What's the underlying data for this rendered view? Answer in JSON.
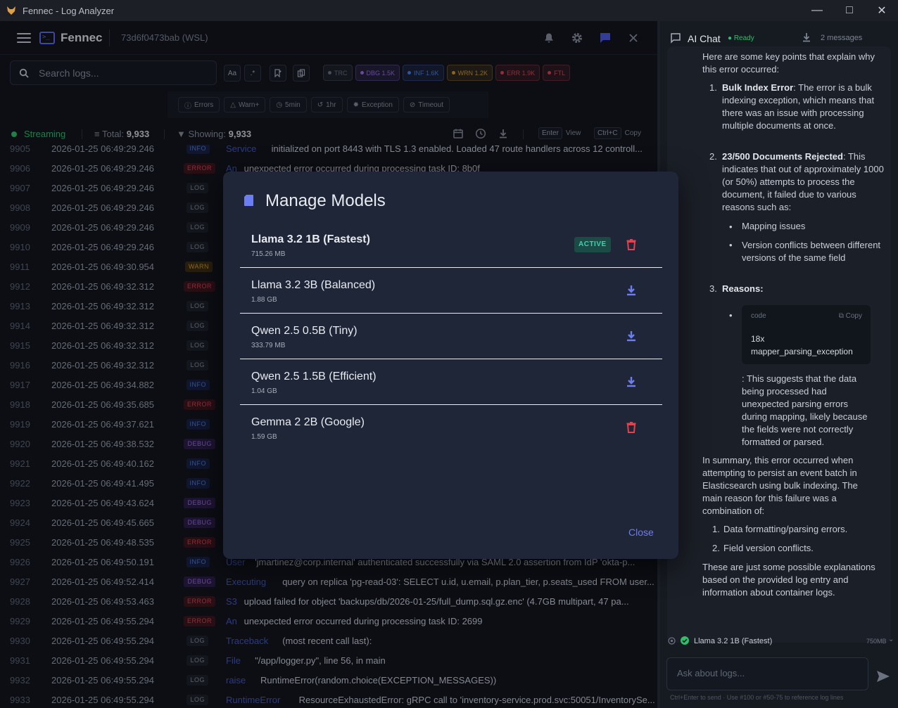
{
  "window": {
    "title": "Fennec - Log Analyzer"
  },
  "header": {
    "brand": "Fennec",
    "host": "73d6f0473bab (WSL)"
  },
  "search": {
    "placeholder": "Search logs..."
  },
  "toolbar": {
    "case_label": "Aa",
    "regex_label": ".*"
  },
  "levels": [
    {
      "label": "TRC",
      "color": "#6b7280"
    },
    {
      "label": "DBG 1.5K",
      "color": "#9b6ef0"
    },
    {
      "label": "INF 1.6K",
      "color": "#4a7ee8"
    },
    {
      "label": "WRN 1.2K",
      "color": "#d79a2c"
    },
    {
      "label": "ERR 1.9K",
      "color": "#e0424f"
    },
    {
      "label": "FTL",
      "color": "#e0424f"
    }
  ],
  "quick_filters": [
    "Errors",
    "Warn+",
    "5min",
    "1hr",
    "Exception",
    "Timeout"
  ],
  "status": {
    "streaming": "Streaming",
    "total_label": "Total:",
    "total": "9,933",
    "showing_label": "Showing:",
    "showing": "9,933",
    "enter_key": "Enter",
    "view": "View",
    "copy_key": "Ctrl+C",
    "copy": "Copy"
  },
  "logs": [
    {
      "ln": "9905",
      "ts": "2026-01-25 06:49:29.246",
      "lvl": "INFO",
      "src": "Service",
      "msg": "initialized on port 8443 with TLS 1.3 enabled. Loaded 47 route handlers across 12 controll..."
    },
    {
      "ln": "9906",
      "ts": "2026-01-25 06:49:29.246",
      "lvl": "ERROR",
      "src": "An",
      "msg": "unexpected error occurred during processing task ID: 8b0f"
    },
    {
      "ln": "9907",
      "ts": "2026-01-25 06:49:29.246",
      "lvl": "LOG",
      "src": "",
      "msg": ""
    },
    {
      "ln": "9908",
      "ts": "2026-01-25 06:49:29.246",
      "lvl": "LOG",
      "src": "",
      "msg": ""
    },
    {
      "ln": "9909",
      "ts": "2026-01-25 06:49:29.246",
      "lvl": "LOG",
      "src": "",
      "msg": ""
    },
    {
      "ln": "9910",
      "ts": "2026-01-25 06:49:29.246",
      "lvl": "LOG",
      "src": "",
      "msg": ""
    },
    {
      "ln": "9911",
      "ts": "2026-01-25 06:49:30.954",
      "lvl": "WARN",
      "src": "",
      "msg": ""
    },
    {
      "ln": "9912",
      "ts": "2026-01-25 06:49:32.312",
      "lvl": "ERROR",
      "src": "",
      "msg": ""
    },
    {
      "ln": "9913",
      "ts": "2026-01-25 06:49:32.312",
      "lvl": "LOG",
      "src": "",
      "msg": ""
    },
    {
      "ln": "9914",
      "ts": "2026-01-25 06:49:32.312",
      "lvl": "LOG",
      "src": "",
      "msg": ""
    },
    {
      "ln": "9915",
      "ts": "2026-01-25 06:49:32.312",
      "lvl": "LOG",
      "src": "",
      "msg": ""
    },
    {
      "ln": "9916",
      "ts": "2026-01-25 06:49:32.312",
      "lvl": "LOG",
      "src": "",
      "msg": ""
    },
    {
      "ln": "9917",
      "ts": "2026-01-25 06:49:34.882",
      "lvl": "INFO",
      "src": "",
      "msg": ""
    },
    {
      "ln": "9918",
      "ts": "2026-01-25 06:49:35.685",
      "lvl": "ERROR",
      "src": "",
      "msg": ""
    },
    {
      "ln": "9919",
      "ts": "2026-01-25 06:49:37.621",
      "lvl": "INFO",
      "src": "",
      "msg": ""
    },
    {
      "ln": "9920",
      "ts": "2026-01-25 06:49:38.532",
      "lvl": "DEBUG",
      "src": "",
      "msg": ""
    },
    {
      "ln": "9921",
      "ts": "2026-01-25 06:49:40.162",
      "lvl": "INFO",
      "src": "",
      "msg": ""
    },
    {
      "ln": "9922",
      "ts": "2026-01-25 06:49:41.495",
      "lvl": "INFO",
      "src": "",
      "msg": ""
    },
    {
      "ln": "9923",
      "ts": "2026-01-25 06:49:43.624",
      "lvl": "DEBUG",
      "src": "",
      "msg": ""
    },
    {
      "ln": "9924",
      "ts": "2026-01-25 06:49:45.665",
      "lvl": "DEBUG",
      "src": "",
      "msg": ""
    },
    {
      "ln": "9925",
      "ts": "2026-01-25 06:49:48.535",
      "lvl": "ERROR",
      "src": "",
      "msg": ""
    },
    {
      "ln": "9926",
      "ts": "2026-01-25 06:49:50.191",
      "lvl": "INFO",
      "src": "User",
      "msg": "'jmartinez@corp.internal' authenticated successfully via SAML 2.0 assertion from IdP 'okta-p..."
    },
    {
      "ln": "9927",
      "ts": "2026-01-25 06:49:52.414",
      "lvl": "DEBUG",
      "src": "Executing",
      "msg": "query on replica 'pg-read-03': SELECT u.id, u.email, p.plan_tier, p.seats_used FROM user..."
    },
    {
      "ln": "9928",
      "ts": "2026-01-25 06:49:53.463",
      "lvl": "ERROR",
      "src": "S3",
      "msg": "upload failed for object 'backups/db/2026-01-25/full_dump.sql.gz.enc' (4.7GB multipart, 47 pa..."
    },
    {
      "ln": "9929",
      "ts": "2026-01-25 06:49:55.294",
      "lvl": "ERROR",
      "src": "An",
      "msg": "unexpected error occurred during processing task ID: 2699"
    },
    {
      "ln": "9930",
      "ts": "2026-01-25 06:49:55.294",
      "lvl": "LOG",
      "src": "Traceback",
      "msg": "(most recent call last):"
    },
    {
      "ln": "9931",
      "ts": "2026-01-25 06:49:55.294",
      "lvl": "LOG",
      "src": "File",
      "msg": "\"/app/logger.py\", line 56, in main"
    },
    {
      "ln": "9932",
      "ts": "2026-01-25 06:49:55.294",
      "lvl": "LOG",
      "src": "raise",
      "msg": "RuntimeError(random.choice(EXCEPTION_MESSAGES))"
    },
    {
      "ln": "9933",
      "ts": "2026-01-25 06:49:55.294",
      "lvl": "LOG",
      "src": "RuntimeError",
      "msg": "ResourceExhaustedError: gRPC call to 'inventory-service.prod.svc:50051/InventorySe..."
    }
  ],
  "chat": {
    "title": "AI Chat",
    "status": "Ready",
    "message_count": "2 messages",
    "intro": "Here are some key points that explain why this error occurred:",
    "p1_title": "Bulk Index Error",
    "p1_text": ": The error is a bulk indexing exception, which means that there was an issue with processing multiple documents at once.",
    "p2_title": "23/500 Documents Rejected",
    "p2_text": ": This indicates that out of approximately 1000 (or 50%) attempts to process the document, it failed due to various reasons such as:",
    "b1": "Mapping issues",
    "b2": "Version conflicts between different versions of the same field",
    "p3_title": "Reasons:",
    "code_lang": "code",
    "code_copy": "Copy",
    "code_line1": "18x",
    "code_line2": "mapper_parsing_exception",
    "after_code": ": This suggests that the data being processed had unexpected parsing errors during mapping, likely because the fields were not correctly formatted or parsed.",
    "summary": "In summary, this error occurred when attempting to persist an event batch in Elasticsearch using bulk indexing. The main reason for this failure was a combination of:",
    "s1": "Data formatting/parsing errors.",
    "s2": "Field version conflicts.",
    "closing": "These are just some possible explanations based on the provided log entry and information about container logs.",
    "model": "Llama 3.2 1B (Fastest)",
    "model_size": "750MB",
    "input_placeholder": "Ask about logs...",
    "hint": "Ctrl+Enter to send  ·  Use #100 or #50-75 to reference log lines"
  },
  "modal": {
    "title": "Manage Models",
    "active_label": "ACTIVE",
    "close_label": "Close",
    "models": [
      {
        "name": "Llama 3.2 1B (Fastest)",
        "size": "715.26 MB",
        "state": "active"
      },
      {
        "name": "Llama 3.2 3B (Balanced)",
        "size": "1.88 GB",
        "state": "download"
      },
      {
        "name": "Qwen 2.5 0.5B (Tiny)",
        "size": "333.79 MB",
        "state": "download"
      },
      {
        "name": "Qwen 2.5 1.5B (Efficient)",
        "size": "1.04 GB",
        "state": "download"
      },
      {
        "name": "Gemma 2 2B (Google)",
        "size": "1.59 GB",
        "state": "installed"
      }
    ]
  }
}
